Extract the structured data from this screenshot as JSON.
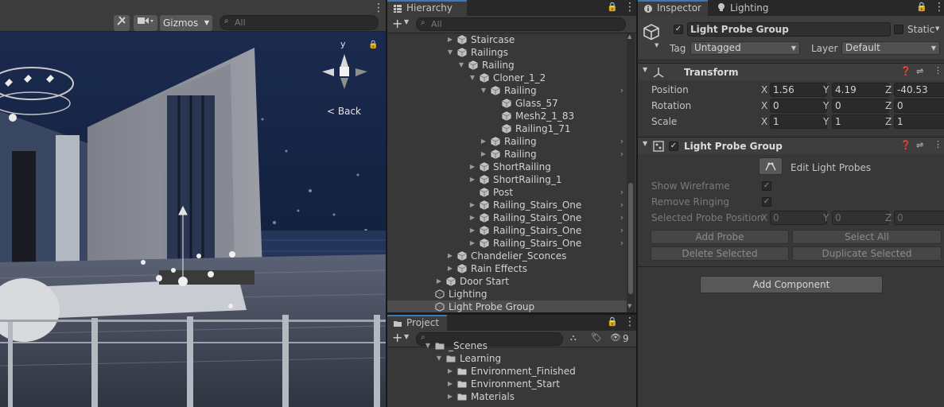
{
  "scene": {
    "gizmos_label": "Gizmos",
    "search_placeholder": "All",
    "back_label": "Back",
    "axis_y": "y"
  },
  "hierarchy": {
    "tab_label": "Hierarchy",
    "search_placeholder": "All",
    "items": [
      {
        "label": "Staircase"
      },
      {
        "label": "Railings"
      },
      {
        "label": "Railing"
      },
      {
        "label": "Cloner_1_2"
      },
      {
        "label": "Railing"
      },
      {
        "label": "Glass_57"
      },
      {
        "label": "Mesh2_1_83"
      },
      {
        "label": "Railing1_71"
      },
      {
        "label": "Railing"
      },
      {
        "label": "Railing"
      },
      {
        "label": "ShortRailing"
      },
      {
        "label": "ShortRailing_1"
      },
      {
        "label": "Post"
      },
      {
        "label": "Railing_Stairs_One"
      },
      {
        "label": "Railing_Stairs_One"
      },
      {
        "label": "Railing_Stairs_One"
      },
      {
        "label": "Railing_Stairs_One"
      },
      {
        "label": "Chandelier_Sconces"
      },
      {
        "label": "Rain Effects"
      },
      {
        "label": "Door Start"
      },
      {
        "label": "Lighting"
      },
      {
        "label": "Light Probe Group"
      }
    ]
  },
  "project": {
    "tab_label": "Project",
    "hidden_count": "9",
    "items": [
      {
        "label": "_Scenes"
      },
      {
        "label": "Learning"
      },
      {
        "label": "Environment_Finished"
      },
      {
        "label": "Environment_Start"
      },
      {
        "label": "Materials"
      }
    ]
  },
  "inspector": {
    "tab_label": "Inspector",
    "lighting_tab_label": "Lighting",
    "object_name": "Light Probe Group",
    "static_label": "Static",
    "tag_label": "Tag",
    "tag_value": "Untagged",
    "layer_label": "Layer",
    "layer_value": "Default",
    "transform": {
      "title": "Transform",
      "position_label": "Position",
      "rotation_label": "Rotation",
      "scale_label": "Scale",
      "position": {
        "x": "1.56",
        "y": "4.19",
        "z": "-40.53"
      },
      "rotation": {
        "x": "0",
        "y": "0",
        "z": "0"
      },
      "scale": {
        "x": "1",
        "y": "1",
        "z": "1"
      }
    },
    "light_probe": {
      "title": "Light Probe Group",
      "edit_label": "Edit Light Probes",
      "show_wireframe_label": "Show Wireframe",
      "remove_ringing_label": "Remove Ringing",
      "selected_probe_label": "Selected Probe Position",
      "selected": {
        "x": "0",
        "y": "0",
        "z": "0"
      },
      "add_probe": "Add Probe",
      "select_all": "Select All",
      "delete_selected": "Delete Selected",
      "duplicate_selected": "Duplicate Selected"
    },
    "add_component": "Add Component",
    "axis_x": "X",
    "axis_y": "Y",
    "axis_z": "Z"
  },
  "colors": {
    "accent": "#3a79bb",
    "panel": "#383838",
    "selection": "#4d4d4d"
  }
}
